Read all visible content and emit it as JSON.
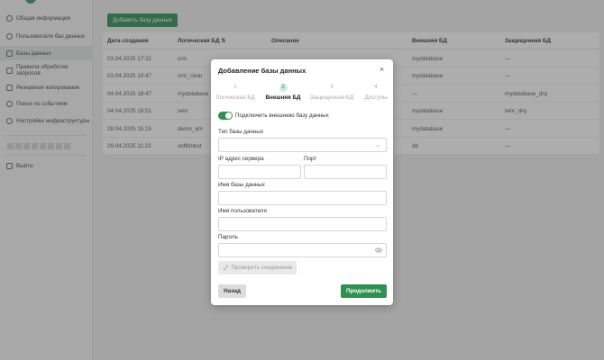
{
  "sidebar": {
    "items": [
      {
        "label": "Общая информация",
        "icon": "info-icon"
      },
      {
        "label": "Пользователи баз данных",
        "icon": "users-icon"
      },
      {
        "label": "Базы данных",
        "icon": "database-icon",
        "active": true
      },
      {
        "label": "Правила обработки запросов",
        "icon": "rules-icon"
      },
      {
        "label": "Резервное копирование",
        "icon": "backup-icon"
      },
      {
        "label": "Поиск по событиям",
        "icon": "search-icon"
      },
      {
        "label": "Настройки инфраструктуры",
        "icon": "gear-icon"
      }
    ],
    "logout_label": "Выйти"
  },
  "main": {
    "add_button_label": "Добавить базу данных",
    "table": {
      "columns": [
        "Дата создания",
        "Логическая БД ⇅",
        "Описание",
        "Внешняя БД",
        "Защищенная БД"
      ],
      "rows": [
        [
          "03.04.2025 17:32",
          "crm",
          "",
          "mydatabase",
          "—"
        ],
        [
          "03.04.2025 19:47",
          "crm_clear",
          "",
          "mydatabase",
          "—"
        ],
        [
          "04.04.2025 18:47",
          "mydatabase",
          "",
          "—",
          "mydatabase_drq"
        ],
        [
          "04.04.2025 18:51",
          "twin",
          "",
          "mydatabase",
          "twin_drq"
        ],
        [
          "28.04.2025 15:15",
          "demo_am",
          "",
          "mydatabase",
          "—"
        ],
        [
          "29.04.2025 11:23",
          "softlintest",
          "",
          "db",
          "—"
        ]
      ]
    }
  },
  "modal": {
    "title": "Добавление базы данных",
    "steps": [
      {
        "num": "1",
        "label": "Логическая БД",
        "active": false
      },
      {
        "num": "2",
        "label": "Внешняя БД",
        "active": true
      },
      {
        "num": "3",
        "label": "Защищенная БД",
        "active": false
      },
      {
        "num": "4",
        "label": "Доступы",
        "active": false
      }
    ],
    "toggle_label": "Подключить внешнюю базу данных",
    "toggle_on": true,
    "db_type_label": "Тип базы данных",
    "db_type_value": "",
    "ip_label": "IP адрес сервера",
    "ip_value": "",
    "port_label": "Порт",
    "port_value": "",
    "db_name_label": "Имя базы данных",
    "db_name_value": "",
    "username_label": "Имя пользователя",
    "username_value": "",
    "password_label": "Пароль",
    "password_value": "",
    "check_connection_label": "Проверить соединение",
    "back_label": "Назад",
    "next_label": "Продолжить"
  },
  "colors": {
    "accent": "#2e9152",
    "overlay": "rgba(60,60,60,0.42)"
  }
}
